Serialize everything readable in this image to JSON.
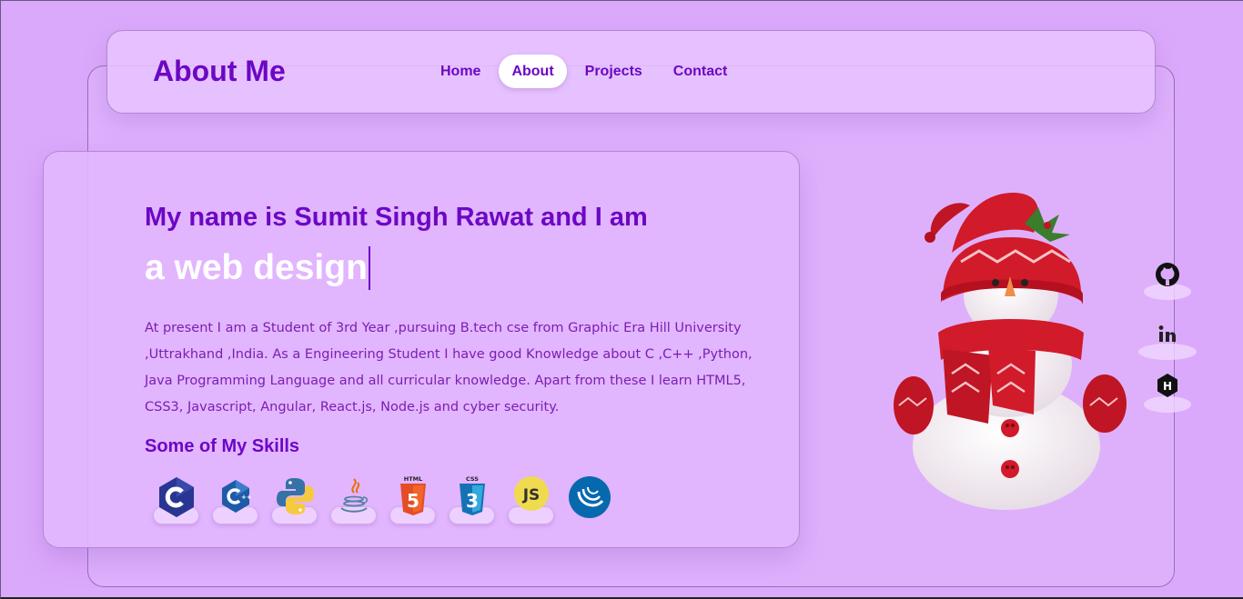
{
  "navbar": {
    "brand": "About Me",
    "items": [
      {
        "label": "Home",
        "active": false
      },
      {
        "label": "About",
        "active": true
      },
      {
        "label": "Projects",
        "active": false
      },
      {
        "label": "Contact",
        "active": false
      }
    ]
  },
  "about": {
    "heading": "My name is Sumit Singh Rawat and I am",
    "typing_text": "a web design",
    "description": "At present I am a Student of 3rd Year ,pursuing B.tech cse from Graphic Era Hill University ,Uttrakhand ,India. As a Engineering Student I have good Knowledge about C ,C++ ,Python, Java Programming Language and all curricular knowledge. Apart from these I learn HTML5, CSS3, Javascript, Angular, React.js, Node.js and cyber security.",
    "skills_title": "Some of My Skills",
    "skills": [
      {
        "name": "c-icon"
      },
      {
        "name": "cpp-icon"
      },
      {
        "name": "python-icon"
      },
      {
        "name": "java-icon"
      },
      {
        "name": "html5-icon",
        "badge": "HTML"
      },
      {
        "name": "css3-icon",
        "badge": "CSS"
      },
      {
        "name": "javascript-icon",
        "badge": "JS"
      },
      {
        "name": "jquery-icon"
      }
    ]
  },
  "social": {
    "icons": [
      "github-icon",
      "linkedin-icon",
      "hashnode-icon"
    ]
  },
  "colors": {
    "background": "#dba9fb",
    "accent": "#6c07c4",
    "text": "#7a1fb0"
  }
}
